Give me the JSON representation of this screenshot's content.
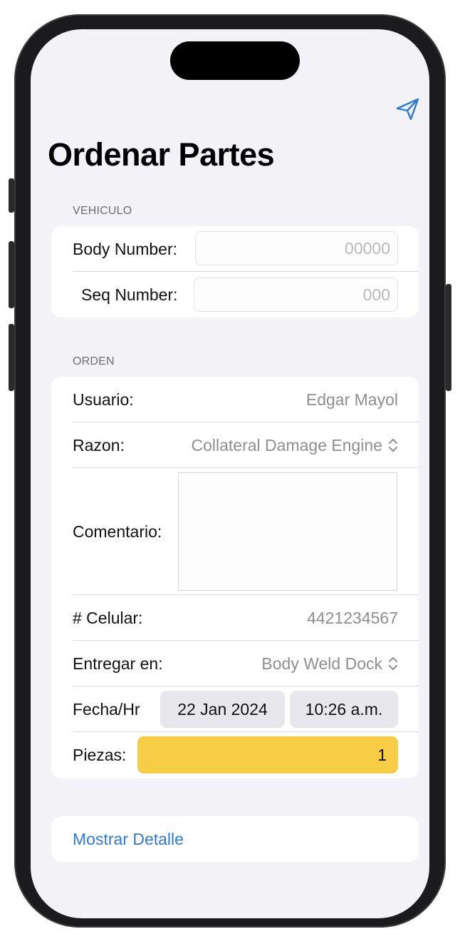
{
  "header": {
    "title": "Ordenar Partes",
    "send_icon": "paperplane-icon"
  },
  "vehiculo": {
    "section_title": "VEHICULO",
    "body_number_label": "Body Number:",
    "body_number_placeholder": "00000",
    "seq_number_label": "Seq Number:",
    "seq_number_placeholder": "000"
  },
  "orden": {
    "section_title": "ORDEN",
    "usuario_label": "Usuario:",
    "usuario_value": "Edgar Mayol",
    "razon_label": "Razon:",
    "razon_value": "Collateral Damage Engine",
    "comentario_label": "Comentario:",
    "comentario_value": "",
    "celular_label": "# Celular:",
    "celular_value": "4421234567",
    "entregar_label": "Entregar en:",
    "entregar_value": "Body Weld Dock",
    "fecha_label": "Fecha/Hr",
    "fecha_value": "22 Jan 2024",
    "hora_value": "10:26 a.m.",
    "piezas_label": "Piezas:",
    "piezas_value": "1"
  },
  "footer": {
    "mostrar_detalle": "Mostrar Detalle"
  },
  "colors": {
    "accent": "#2f7ad6",
    "piezas_highlight": "#f6cd45",
    "background": "#f2f2f7"
  }
}
